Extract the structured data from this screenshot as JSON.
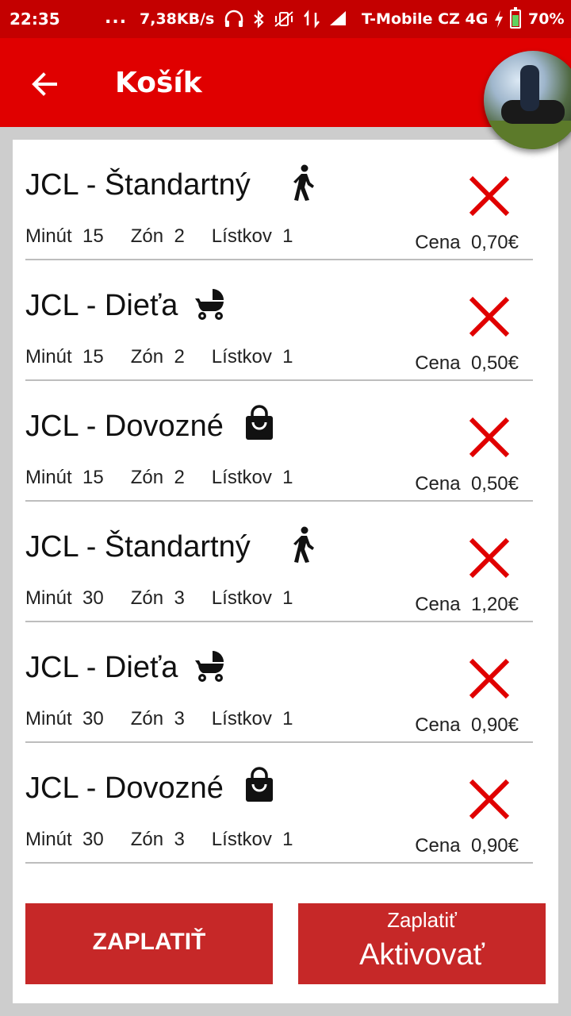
{
  "status_bar": {
    "time": "22:35",
    "dots": "...",
    "speed": "7,38KB/s",
    "carrier": "T-Mobile CZ 4G",
    "battery": "70%",
    "battery_level": 0.7
  },
  "app_bar": {
    "title": "Košík",
    "back_icon": "arrow-left-icon"
  },
  "labels": {
    "minutes": "Minút",
    "zones": "Zón",
    "tickets": "Lístkov",
    "price": "Cena"
  },
  "items": [
    {
      "name": "JCL - Štandartný",
      "icon": "walking-person-icon",
      "minutes": "15",
      "zones": "2",
      "tickets": "1",
      "price": "0,70€"
    },
    {
      "name": "JCL - Dieťa",
      "icon": "stroller-icon",
      "minutes": "15",
      "zones": "2",
      "tickets": "1",
      "price": "0,50€"
    },
    {
      "name": "JCL - Dovozné",
      "icon": "shopping-bag-icon",
      "minutes": "15",
      "zones": "2",
      "tickets": "1",
      "price": "0,50€"
    },
    {
      "name": "JCL - Štandartný",
      "icon": "walking-person-icon",
      "minutes": "30",
      "zones": "3",
      "tickets": "1",
      "price": "1,20€"
    },
    {
      "name": "JCL - Dieťa",
      "icon": "stroller-icon",
      "minutes": "30",
      "zones": "3",
      "tickets": "1",
      "price": "0,90€"
    },
    {
      "name": "JCL - Dovozné",
      "icon": "shopping-bag-icon",
      "minutes": "30",
      "zones": "3",
      "tickets": "1",
      "price": "0,90€"
    }
  ],
  "buttons": {
    "pay": "ZAPLATIŤ",
    "pay_activate_small": "Zaplatiť",
    "pay_activate_big": "Aktivovať"
  },
  "colors": {
    "app_bar": "#e00000",
    "status_bar": "#c40000",
    "button": "#c62828",
    "delete": "#e00000"
  }
}
